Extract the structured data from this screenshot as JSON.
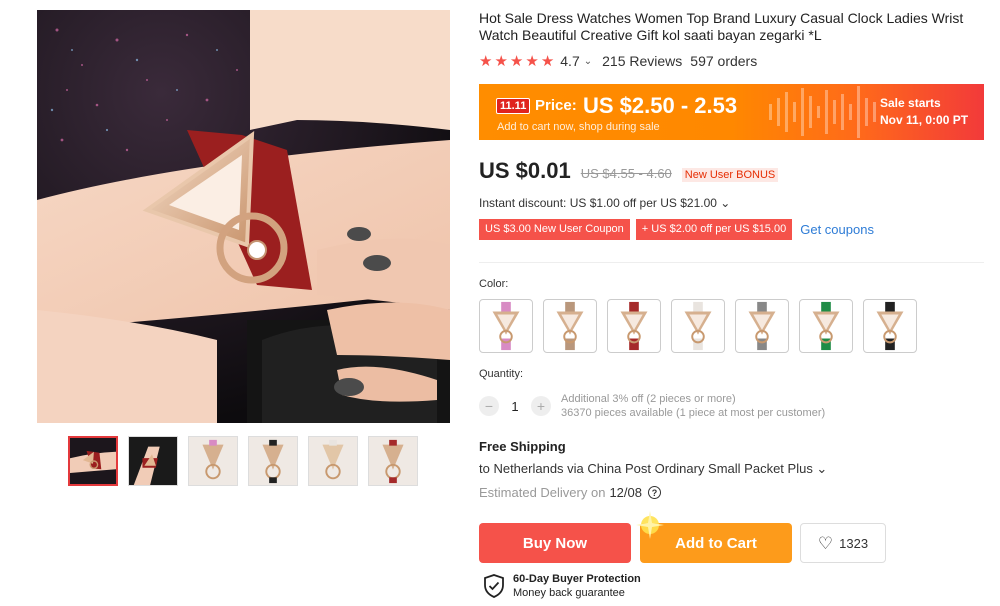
{
  "product": {
    "title": "Hot Sale Dress Watches Women Top Brand Luxury Casual Clock Ladies Wrist Watch Beautiful Creative Gift kol saati bayan zegarki *L",
    "rating": "4.7",
    "reviews": "215 Reviews",
    "orders": "597 orders"
  },
  "sale": {
    "tag": "11.11",
    "price_label": "Price:",
    "price_range": "US $2.50 - 2.53",
    "subtext": "Add to cart now, shop during sale",
    "starts_line1": "Sale starts",
    "starts_line2": "Nov 11, 0:00 PT"
  },
  "pricing": {
    "current": "US $0.01",
    "original": "US $4.55 - 4.60",
    "bonus": "New User BONUS",
    "instant_discount": "Instant discount: US $1.00 off per US $21.00 ⌄"
  },
  "coupons": {
    "items": [
      "US $3.00 New User Coupon",
      "+ US $2.00 off per US $15.00"
    ],
    "get_label": "Get coupons"
  },
  "color": {
    "label": "Color:",
    "options": [
      {
        "name": "pink-swatch",
        "strap": "#d88bc4"
      },
      {
        "name": "khaki-swatch",
        "strap": "#b9977c"
      },
      {
        "name": "red-swatch",
        "strap": "#a52a2a"
      },
      {
        "name": "white-swatch",
        "strap": "#e9e4df"
      },
      {
        "name": "grey-swatch",
        "strap": "#888888"
      },
      {
        "name": "green-swatch",
        "strap": "#1f8c46"
      },
      {
        "name": "black-swatch",
        "strap": "#222222"
      }
    ]
  },
  "quantity": {
    "label": "Quantity:",
    "value": "1",
    "minus": "−",
    "plus": "+",
    "info_line1": "Additional 3% off (2 pieces or more)",
    "info_line2": "36370 pieces available (1 piece at most per customer)"
  },
  "shipping": {
    "title": "Free Shipping",
    "to": "to Netherlands via China Post Ordinary Small Packet Plus ⌄",
    "estimated_label": "Estimated Delivery on",
    "estimated_date": "12/08",
    "help": "?"
  },
  "actions": {
    "buy_now": "Buy Now",
    "add_to_cart": "Add to Cart",
    "wishlist_count": "1323"
  },
  "protection": {
    "title": "60-Day Buyer Protection",
    "subtitle": "Money back guarantee"
  },
  "icons": {
    "star": "★",
    "heart": "♡",
    "chevron": "⌄"
  },
  "colors": {
    "accent_red": "#f5524a",
    "accent_orange": "#fd9b1b",
    "link_blue": "#2e7cd6"
  }
}
